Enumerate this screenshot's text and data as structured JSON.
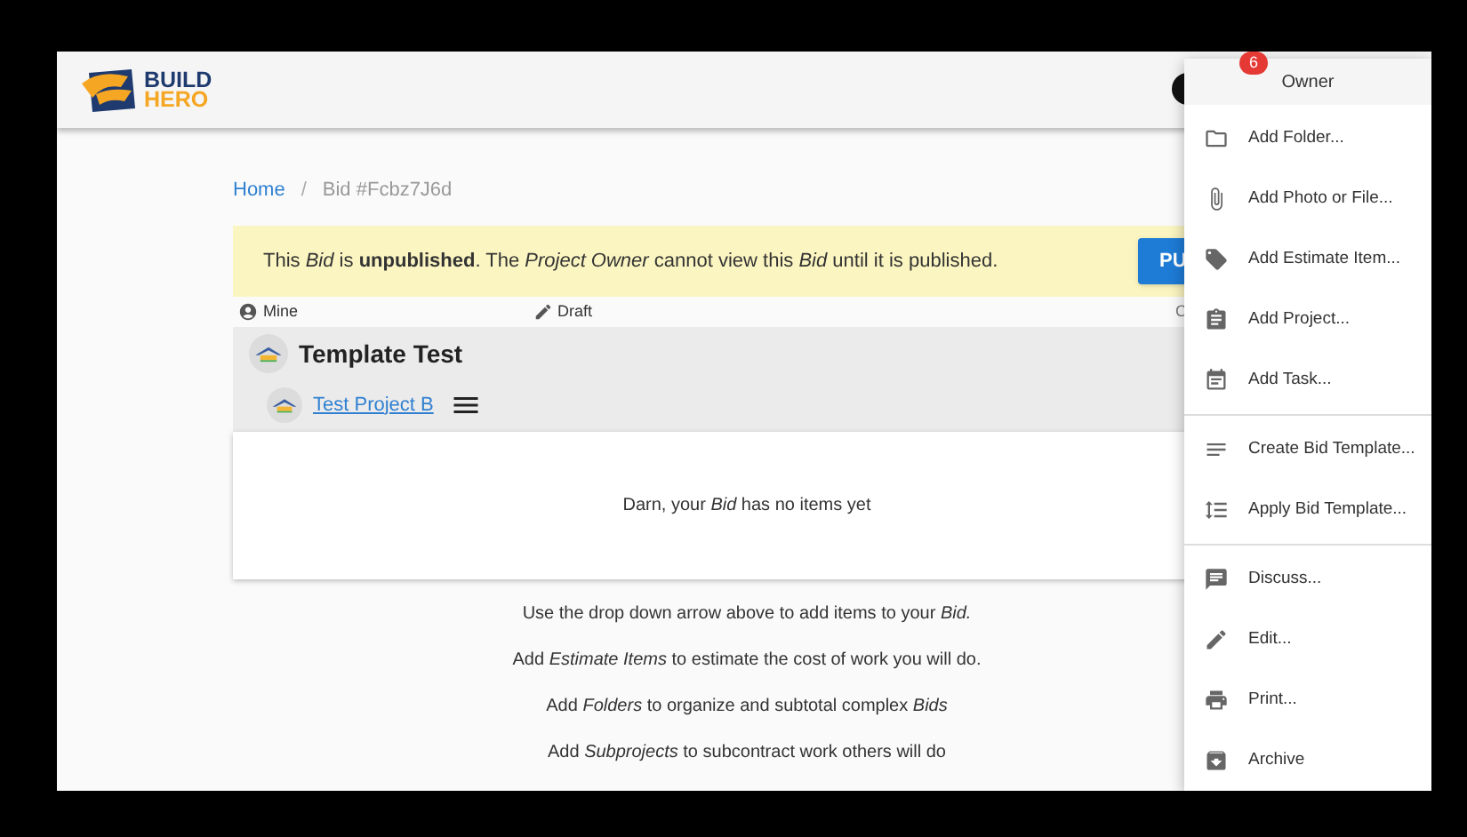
{
  "header": {
    "logo_line1": "BUILD",
    "logo_line2": "HERO",
    "badge": "6"
  },
  "breadcrumb": {
    "home": "Home",
    "separator": "/",
    "current": "Bid #Fcbz7J6d"
  },
  "banner": {
    "text": "This *Bid* is **unpublished**. The *Project Owner* cannot view this *Bid* until it is published.",
    "button": "PU"
  },
  "meta": {
    "owner": "Mine",
    "status": "Draft",
    "column_3": "C"
  },
  "bid": {
    "title": "Template Test",
    "project_link": "Test Project B"
  },
  "empty_message": "Darn, your *Bid* has no items yet",
  "hints": [
    "Use the drop down arrow above to add items to your *Bid.*",
    "Add *Estimate Items* to estimate the cost of work you will do.",
    "Add *Folders* to organize and subtotal complex *Bids*",
    "Add *Subprojects* to subcontract work others will do"
  ],
  "menu": {
    "title": "Owner",
    "groups": [
      [
        "Add Folder...",
        "Add Photo or File...",
        "Add Estimate Item...",
        "Add Project...",
        "Add Task..."
      ],
      [
        "Create Bid Template...",
        "Apply Bid Template..."
      ],
      [
        "Discuss...",
        "Edit...",
        "Print...",
        "Archive"
      ]
    ]
  }
}
